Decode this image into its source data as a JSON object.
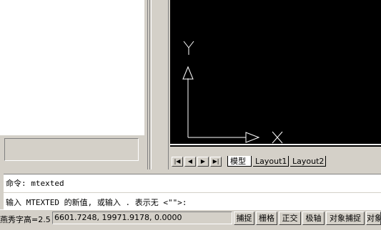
{
  "drawing": {
    "ucs_y_label": "Y",
    "ucs_x_label": "X"
  },
  "tabs": {
    "nav": [
      "|◀",
      "◀",
      "▶",
      "▶|"
    ],
    "model": "模型",
    "layout1": "Layout1",
    "layout2": "Layout2"
  },
  "command": {
    "line1": "命令: mtexted",
    "line2": "输入 MTEXTED 的新值, 或输入 . 表示无 <\"\">:"
  },
  "status": {
    "text_style": "燕秀字高=2.5",
    "coordinates": "6601.7248, 19971.9178, 0.0000",
    "buttons": [
      "捕捉",
      "栅格",
      "正交",
      "极轴",
      "对象捕捉",
      "对象"
    ]
  },
  "colors": {
    "canvas": "#000000",
    "ucs_icon": "#ffffff",
    "chrome": "#d4d0c8"
  }
}
